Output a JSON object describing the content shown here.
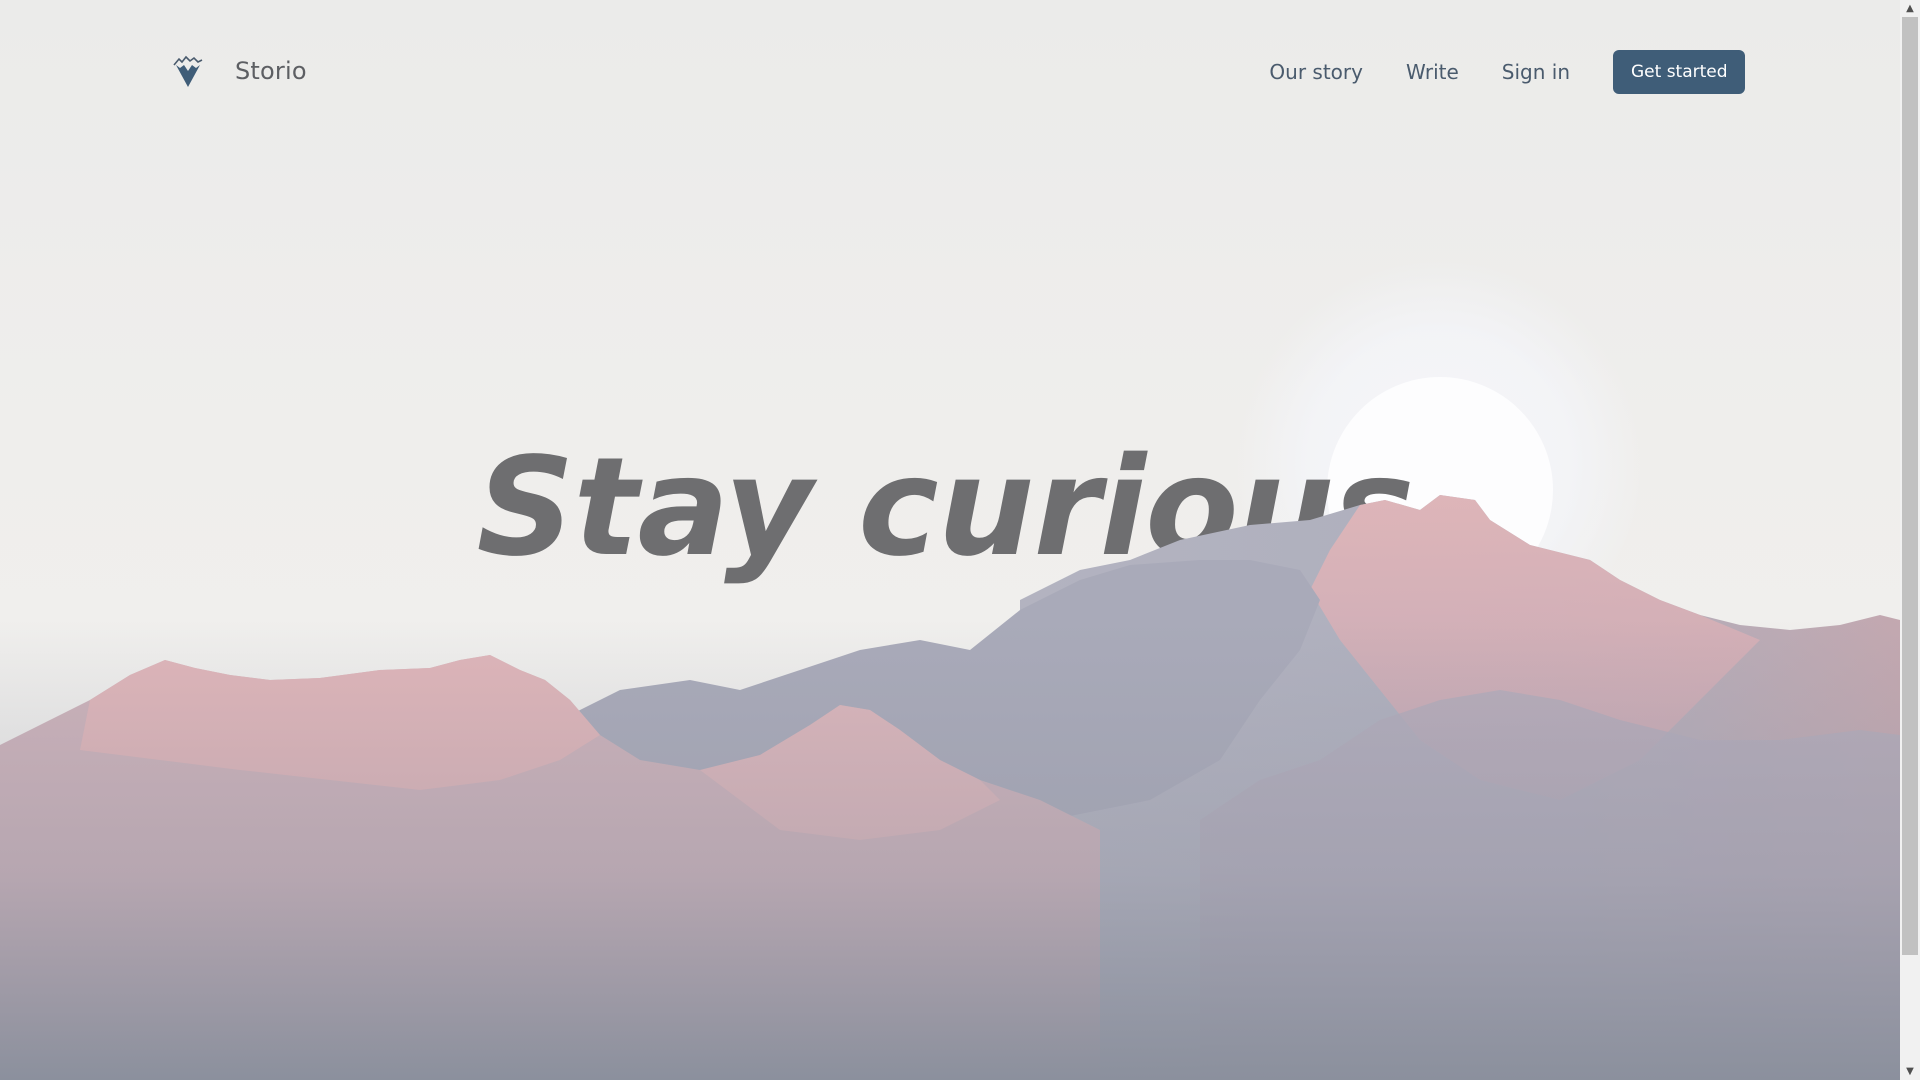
{
  "header": {
    "brand": "Storio",
    "logo_icon": "mountain-heart-icon",
    "nav": [
      {
        "label": "Our story"
      },
      {
        "label": "Write"
      },
      {
        "label": "Sign in"
      }
    ],
    "cta_label": "Get started"
  },
  "hero": {
    "title": "Stay curious"
  },
  "colors": {
    "accent": "#3f5d78",
    "text_nav": "#4a5b6d",
    "title": "#6e6e70",
    "background": "#eeedeb",
    "mountain_pink": "#e8b8b8",
    "mountain_gray": "#9a9cab"
  }
}
